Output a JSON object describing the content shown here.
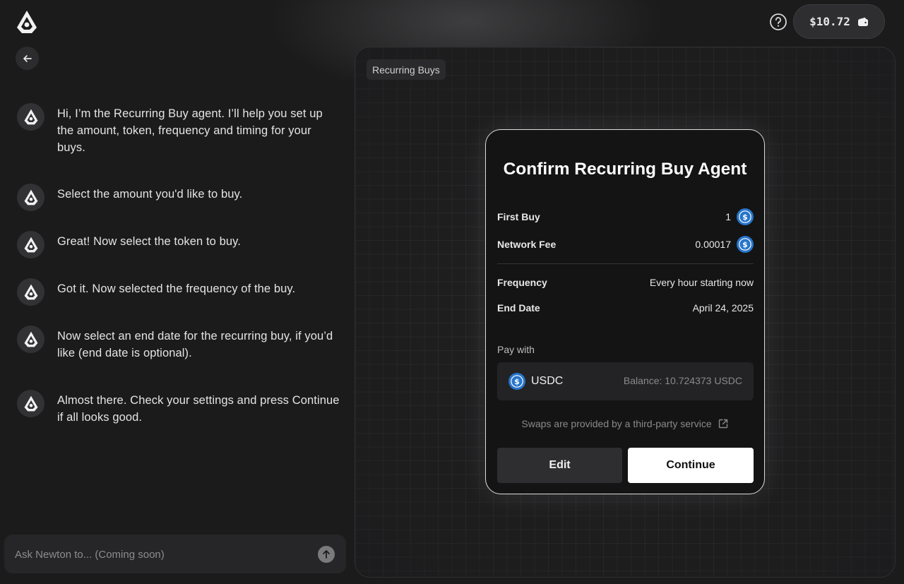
{
  "header": {
    "logo_icon": "newton-logo-icon",
    "back_icon": "arrow-left-icon",
    "help_icon": "question-circle-icon",
    "wallet": {
      "amount": "$10.72",
      "icon": "wallet-icon"
    }
  },
  "chat": {
    "messages": [
      {
        "text": "Hi, I’m the Recurring Buy agent. I’ll help you set up the amount, token, frequency and timing for your buys."
      },
      {
        "text": "Select the amount you'd like to buy."
      },
      {
        "text": "Great! Now select the token to buy."
      },
      {
        "text": "Got it. Now selected the frequency of the buy."
      },
      {
        "text": "Now select an end date for the recurring buy, if you’d like (end date is optional)."
      },
      {
        "text": "Almost there. Check your settings and press Continue if all looks good."
      }
    ],
    "input": {
      "placeholder": "Ask Newton to... (Coming soon)",
      "send_icon": "arrow-up-icon"
    }
  },
  "canvas": {
    "tab_label": "Recurring Buys"
  },
  "confirm": {
    "title": "Confirm Recurring Buy Agent",
    "first_buy": {
      "label": "First Buy",
      "value": "1",
      "token_icon": "usdc-icon"
    },
    "network_fee": {
      "label": "Network Fee",
      "value": "0.00017",
      "token_icon": "usdc-icon"
    },
    "frequency": {
      "label": "Frequency",
      "value": "Every hour starting now"
    },
    "end_date": {
      "label": "End Date",
      "value": "April 24, 2025"
    },
    "pay_with": {
      "label": "Pay with",
      "token": "USDC",
      "balance": "Balance: 10.724373 USDC"
    },
    "disclaimer": "Swaps are provided by a third-party service",
    "edit_label": "Edit",
    "continue_label": "Continue"
  },
  "colors": {
    "usdc_blue": "#2775CA",
    "background": "#1b1b1c",
    "card_border": "#dcdcdc"
  }
}
